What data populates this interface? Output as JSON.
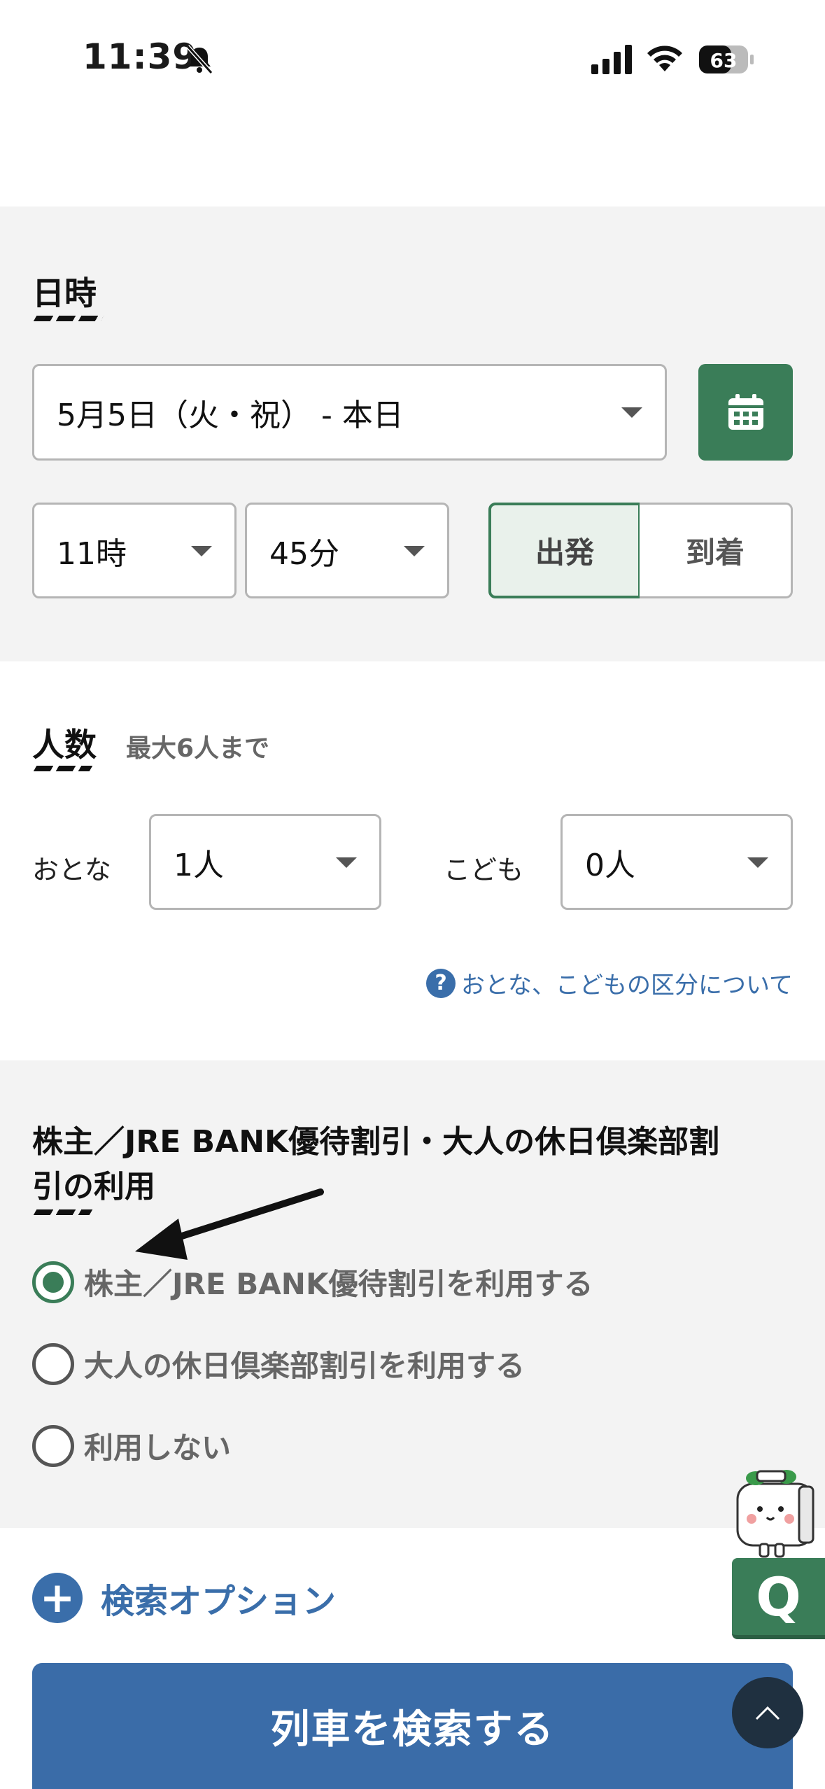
{
  "status_bar": {
    "time": "11:39",
    "battery": "63"
  },
  "datetime_section": {
    "heading": "日時",
    "date_value": "5月5日（火・祝） - 本日",
    "hour_value": "11時",
    "minute_value": "45分",
    "departure_label": "出発",
    "arrival_label": "到着",
    "selected_mode": "出発"
  },
  "people_section": {
    "heading": "人数",
    "note": "最大6人まで",
    "adult_label": "おとな",
    "adult_value": "1人",
    "child_label": "こども",
    "child_value": "0人",
    "help_link": "おとな、こどもの区分について",
    "help_icon": "question-icon"
  },
  "discount_section": {
    "heading_line1": "株主／JRE BANK優待割引・大人の休日倶楽部割",
    "heading_line2": "引の利用",
    "options": [
      {
        "label": "株主／JRE BANK優待割引を利用する",
        "selected": true
      },
      {
        "label": "大人の休日倶楽部割引を利用する",
        "selected": false
      },
      {
        "label": "利用しない",
        "selected": false
      }
    ]
  },
  "search_options": {
    "label": "検索オプション"
  },
  "search_button": {
    "label": "列車を検索する"
  },
  "floating": {
    "q_label": "Q"
  },
  "colors": {
    "green": "#3a7d58",
    "blue": "#3a6ca8",
    "gray_bg": "#f3f3f3"
  }
}
